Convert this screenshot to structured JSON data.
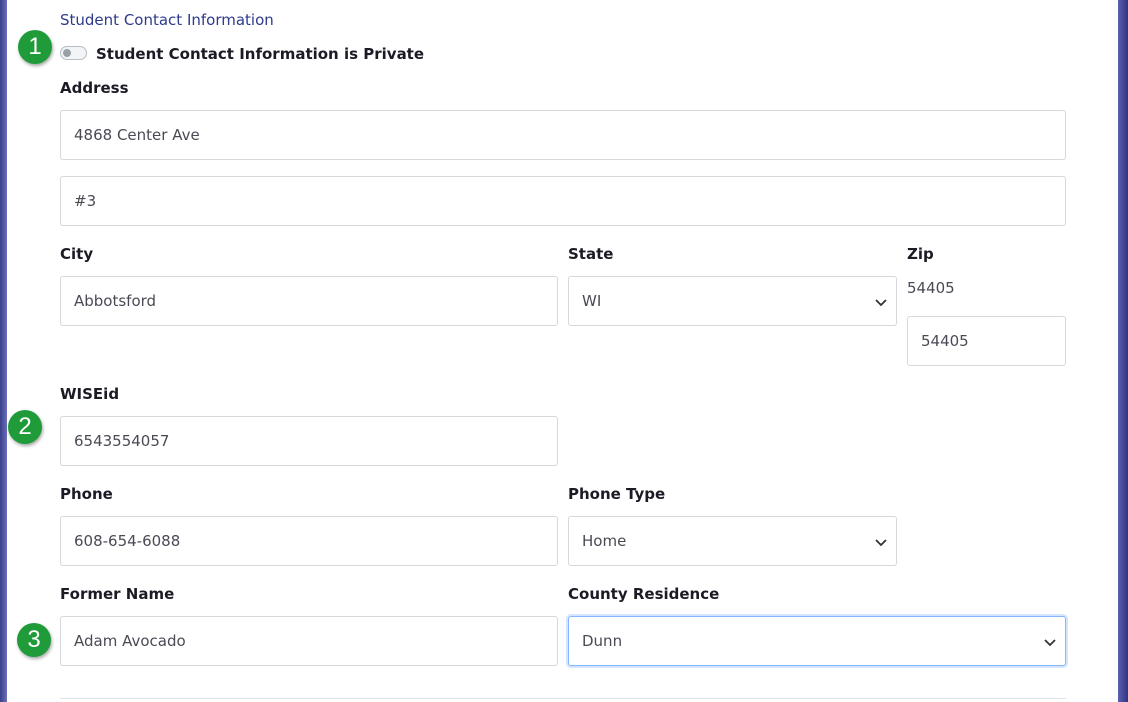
{
  "section_title": "Student Contact Information",
  "private_toggle": {
    "label": "Student Contact Information is Private",
    "checked": false
  },
  "address": {
    "label": "Address",
    "line1": "4868 Center Ave",
    "line2": "#3"
  },
  "city": {
    "label": "City",
    "value": "Abbotsford"
  },
  "state": {
    "label": "State",
    "value": "WI"
  },
  "zip": {
    "label": "Zip",
    "display": "54405",
    "value": "54405"
  },
  "wiseid": {
    "label": "WISEid",
    "value": "6543554057"
  },
  "phone": {
    "label": "Phone",
    "value": "608-654-6088"
  },
  "phone_type": {
    "label": "Phone Type",
    "value": "Home"
  },
  "former_name": {
    "label": "Former Name",
    "value": "Adam Avocado"
  },
  "county_residence": {
    "label": "County Residence",
    "value": "Dunn"
  },
  "badges": [
    "1",
    "2",
    "3"
  ],
  "icons": {
    "select_arrow": "chevron-down-icon"
  },
  "colors": {
    "accent": "#2e3a8c",
    "badge": "#1f9b3a",
    "focus": "#86b7fe"
  }
}
